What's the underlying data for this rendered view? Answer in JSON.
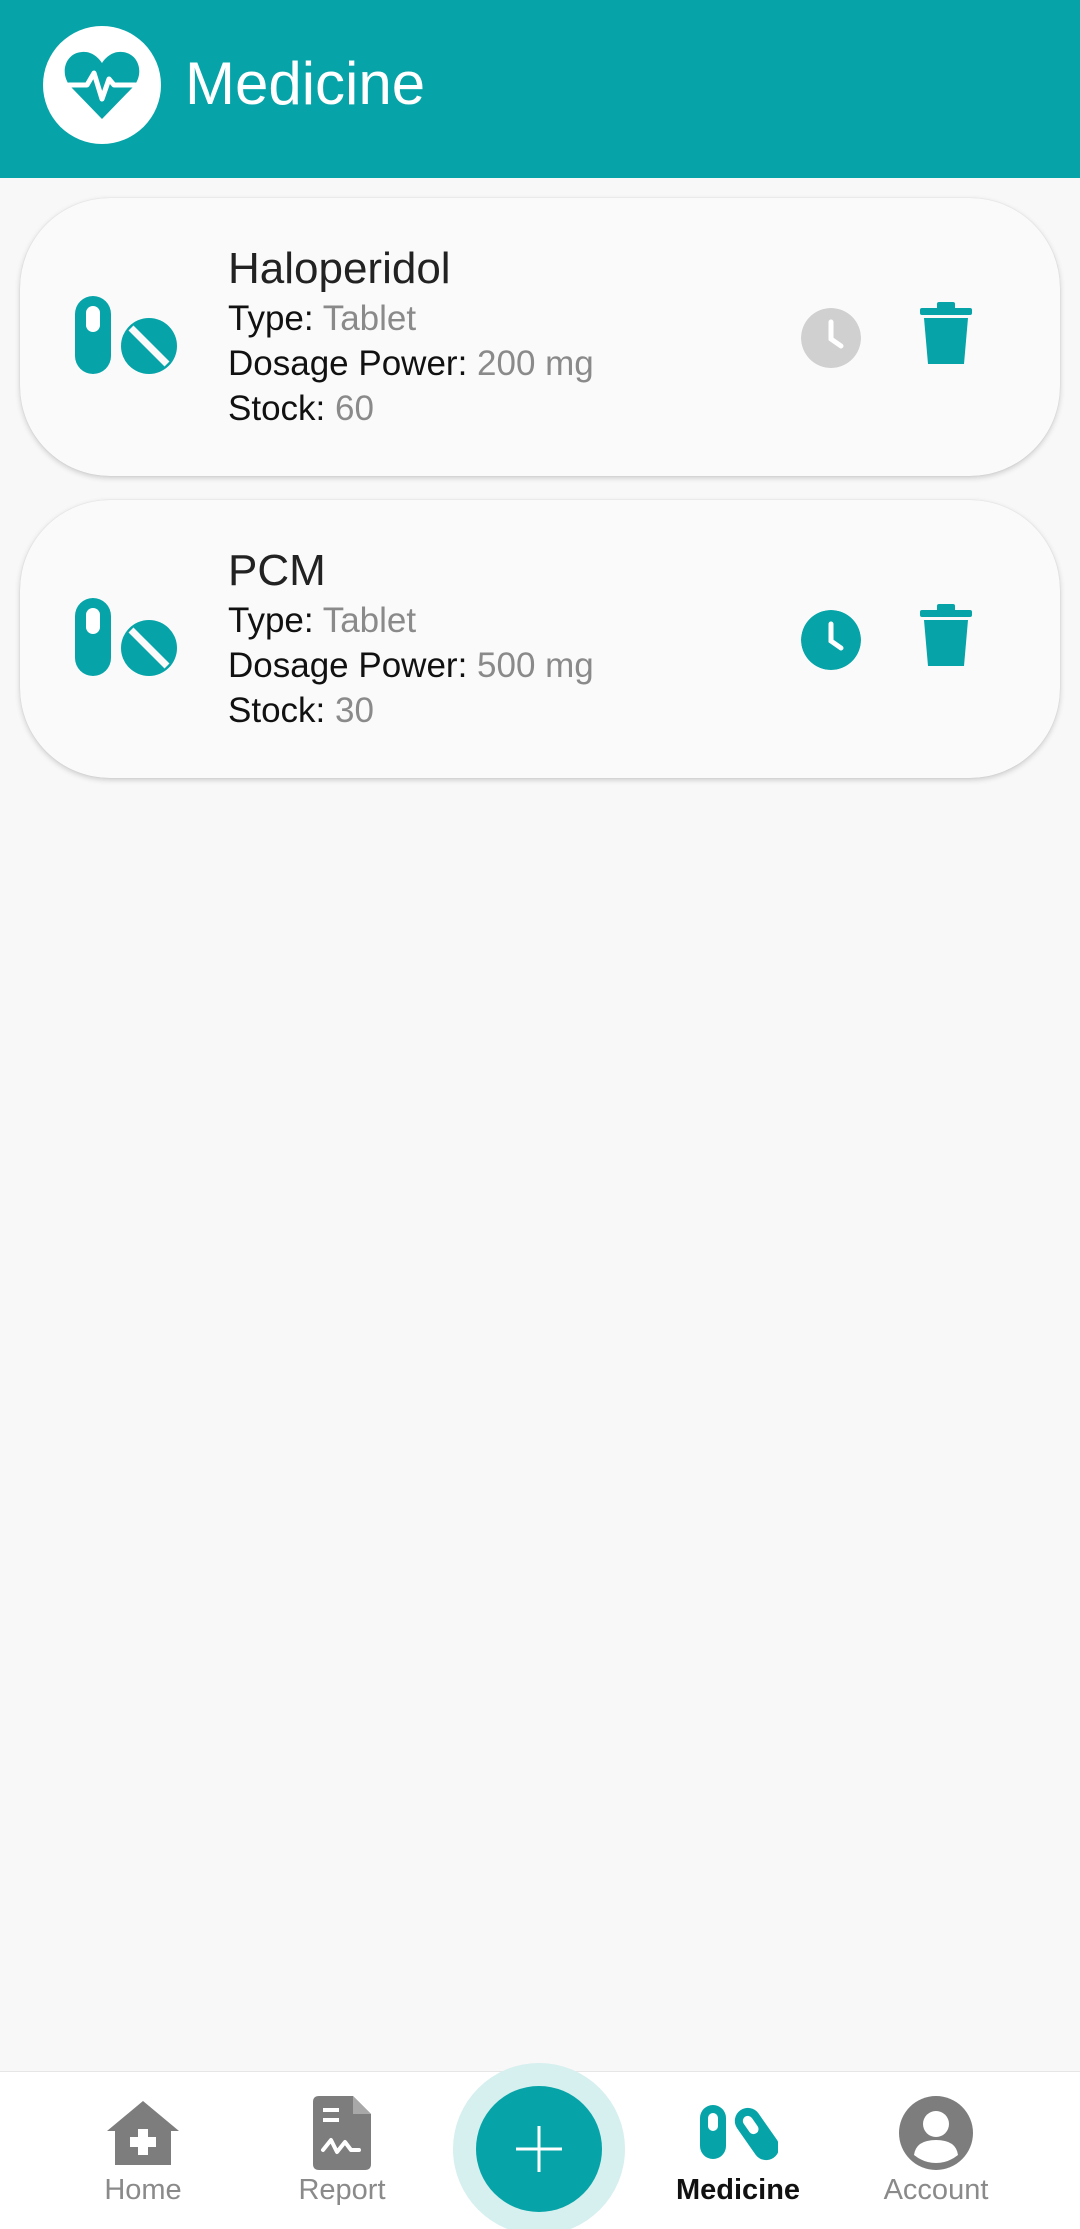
{
  "header": {
    "title": "Medicine",
    "logo_icon": "heart-pulse-icon"
  },
  "medicines": [
    {
      "name": "Haloperidol",
      "type_label": "Type:",
      "type": "Tablet",
      "dosage_label": "Dosage Power:",
      "dosage": "200 mg",
      "stock_label": "Stock:",
      "stock": "60",
      "reminder_active": false
    },
    {
      "name": "PCM",
      "type_label": "Type:",
      "type": "Tablet",
      "dosage_label": "Dosage Power:",
      "dosage": "500 mg",
      "stock_label": "Stock:",
      "stock": "30",
      "reminder_active": true
    }
  ],
  "nav": {
    "home": "Home",
    "report": "Report",
    "medicine": "Medicine",
    "account": "Account"
  },
  "colors": {
    "accent": "#06a4a8",
    "inactive_gray": "#8a8a8a",
    "clock_inactive": "#d0d0d0"
  }
}
